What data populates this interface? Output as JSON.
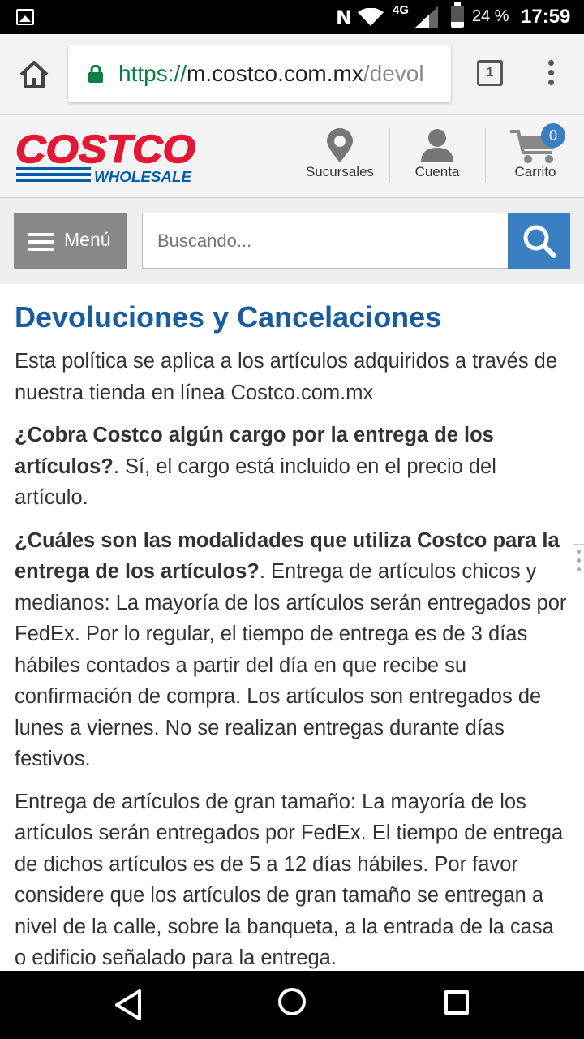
{
  "status_bar": {
    "battery_percent": "24 %",
    "time": "17:59",
    "network": "4G",
    "nfc": "N",
    "icons": [
      "gallery-icon",
      "nfc-icon",
      "wifi-icon",
      "signal-icon",
      "battery-icon"
    ]
  },
  "browser": {
    "url_scheme": "https://",
    "url_host": "m.costco.com.mx",
    "url_path": "/devol",
    "tab_count": "1"
  },
  "header": {
    "logo_text": "COSTCO",
    "logo_subtext": "WHOLESALE",
    "nav": [
      {
        "label": "Sucursales",
        "icon": "location-pin-icon"
      },
      {
        "label": "Cuenta",
        "icon": "user-icon"
      },
      {
        "label": "Carrito",
        "icon": "cart-icon"
      }
    ],
    "cart_count": "0",
    "brand_colors": {
      "red": "#e31837",
      "blue": "#005daa"
    }
  },
  "search": {
    "menu_label": "Menú",
    "placeholder": "Buscando..."
  },
  "content": {
    "title": "Devoluciones y Cancelaciones",
    "intro": "Esta política se aplica a los artículos adquiridos a través de nuestra tienda en línea Costco.com.mx",
    "q1": "¿Cobra Costco algún cargo por la entrega de los artículos?",
    "a1": ". Sí, el cargo está incluido en el precio del artículo.",
    "q2": "¿Cuáles son las modalidades que utiliza Costco para la entrega de los artículos?",
    "a2": ". Entrega de artículos chicos y medianos: La mayoría de los artículos serán entregados por FedEx. Por lo regular, el tiempo de entrega es de 3 días hábiles contados a partir del día en que recibe su confirmación de compra. Los artículos son entregados de lunes a viernes. No se realizan entregas durante días festivos.",
    "p3": "Entrega de artículos de gran tamaño: La mayoría de los artículos serán entregados por FedEx. El tiempo de entrega de dichos artículos es de 5 a 12 días hábiles. Por favor considere que los artículos de gran tamaño se entregan a nivel de la calle, sobre la banqueta, a la entrada de la casa o edificio señalado para la entrega."
  },
  "colors": {
    "title_blue": "#1a5c9e",
    "search_button": "#3a7fc1",
    "menu_button": "#888888",
    "url_green": "#0b8043"
  }
}
